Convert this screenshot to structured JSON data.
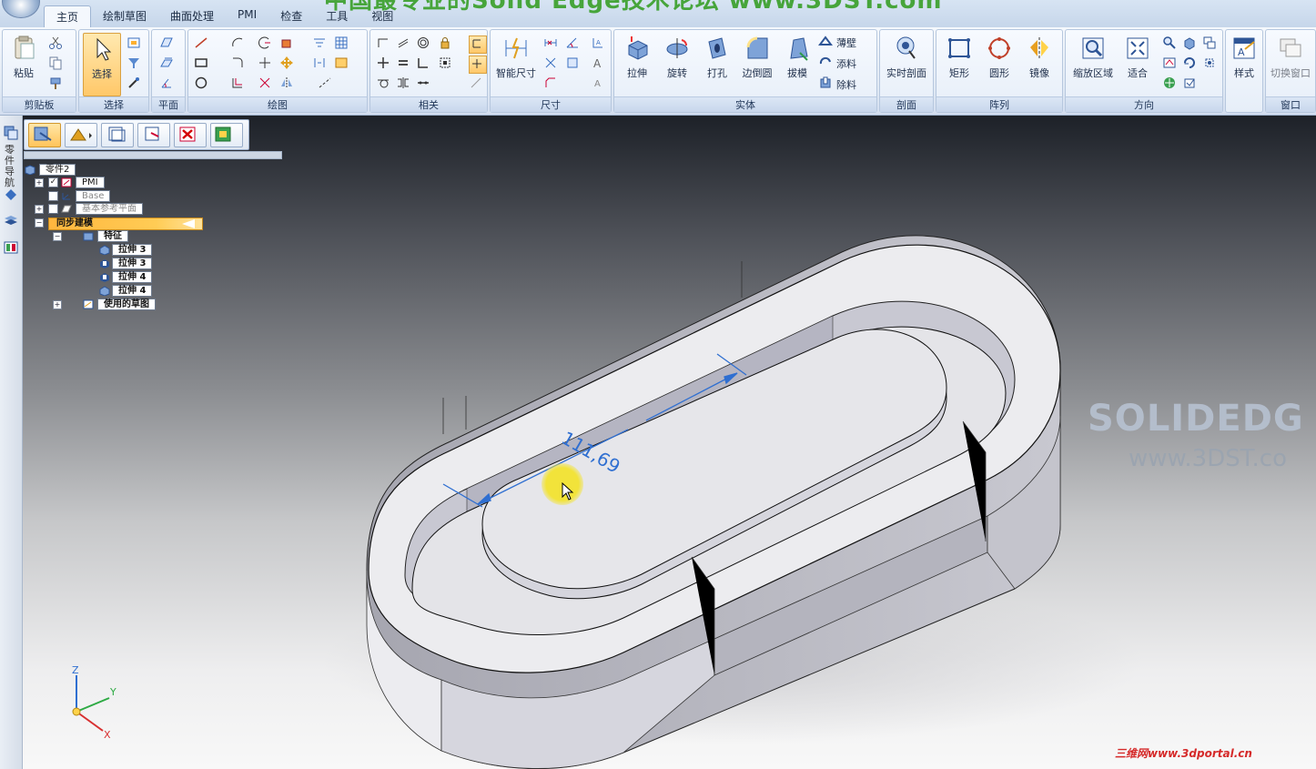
{
  "banner": {
    "text": "中国最专业的Solid Edge技术论坛 www.3DST.com"
  },
  "tabs": [
    "主页",
    "绘制草图",
    "曲面处理",
    "PMI",
    "检查",
    "工具",
    "视图"
  ],
  "ribbon": {
    "clipboard": {
      "paste": "粘贴",
      "group": "剪贴板"
    },
    "select": {
      "select": "选择",
      "group": "选择"
    },
    "plane": {
      "group": "平面"
    },
    "draw": {
      "group": "绘图"
    },
    "relate": {
      "group": "相关"
    },
    "dimension": {
      "smart": "智能尺寸",
      "group": "尺寸"
    },
    "solids": {
      "extrude": "拉伸",
      "revolve": "旋转",
      "hole": "打孔",
      "round": "边倒圆",
      "draft": "拔模",
      "thin_wall": "薄壁",
      "add": "添料",
      "remove": "除料",
      "group": "实体"
    },
    "section": {
      "live": "实时剖面",
      "group": "剖面"
    },
    "pattern": {
      "rect": "矩形",
      "circular": "圆形",
      "mirror": "镜像",
      "group": "阵列"
    },
    "orient": {
      "zoom_area": "缩放区域",
      "fit": "适合",
      "group": "方向"
    },
    "style": {
      "label": "样式"
    },
    "window": {
      "switch": "切换窗口",
      "group": "窗口"
    }
  },
  "left_strip": {
    "label": "零件导航"
  },
  "tree": {
    "root": "零件2",
    "pmi": "PMI",
    "base": "Base",
    "ref_planes": "基本参考平面",
    "sync": "同步建模",
    "features": "特征",
    "items": [
      "拉伸 3",
      "拉伸 3",
      "拉伸 4",
      "拉伸 4"
    ],
    "sketches": "使用的草图"
  },
  "dimension_value": "111,69",
  "triad": {
    "x": "X",
    "y": "Y",
    "z": "Z"
  },
  "watermarks": {
    "logo": "SOLIDEDG",
    "site": "www.3DST.co",
    "portal": "三维网www.3dportal.cn"
  },
  "colors": {
    "accent": "#ffc45b",
    "dimension": "#2f6fd1",
    "banner": "#47a53b"
  }
}
